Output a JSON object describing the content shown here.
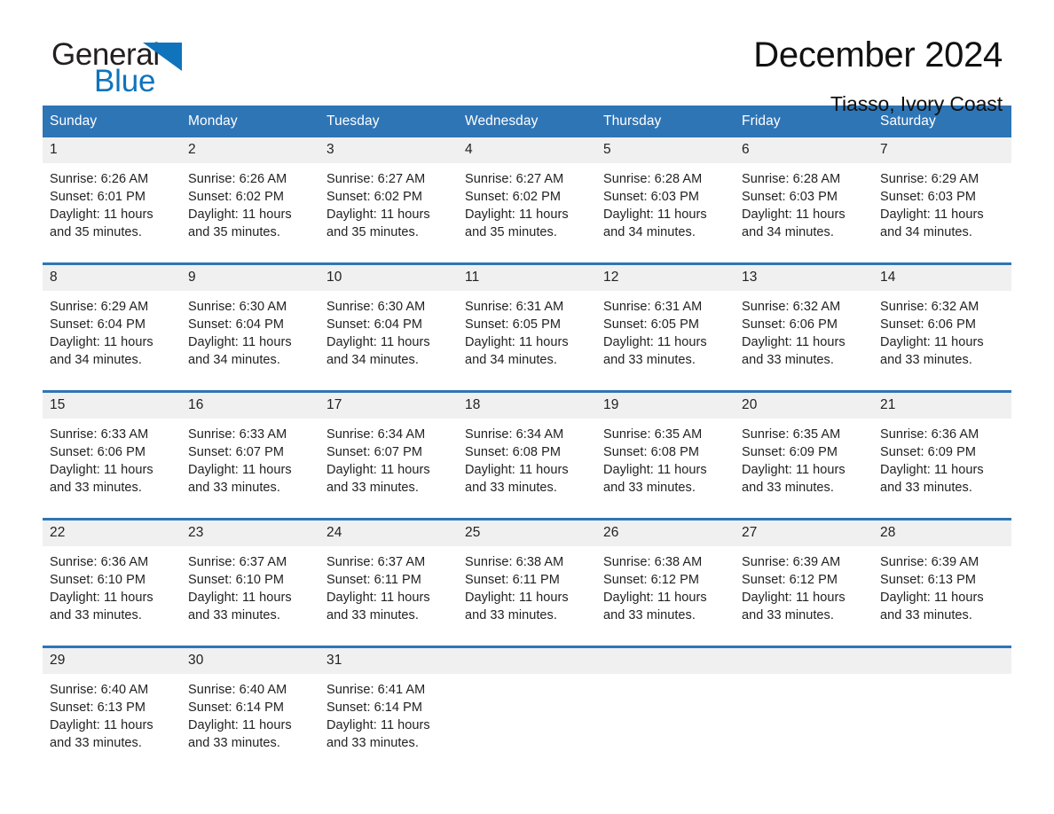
{
  "brand": {
    "name_part1": "General",
    "name_part2": "Blue",
    "logo_icon": "triangle-flag-icon",
    "accent_color": "#0f74bc"
  },
  "header": {
    "title": "December 2024",
    "subtitle": "Tiasso, Ivory Coast"
  },
  "theme": {
    "header_blue": "#2e75b6",
    "daynum_band": "#f0f0f0",
    "text": "#222222"
  },
  "calendar": {
    "weekday_headers": [
      "Sunday",
      "Monday",
      "Tuesday",
      "Wednesday",
      "Thursday",
      "Friday",
      "Saturday"
    ],
    "weeks": [
      {
        "days": [
          {
            "date": "1",
            "sunrise": "Sunrise: 6:26 AM",
            "sunset": "Sunset: 6:01 PM",
            "daylight_line1": "Daylight: 11 hours",
            "daylight_line2": "and 35 minutes."
          },
          {
            "date": "2",
            "sunrise": "Sunrise: 6:26 AM",
            "sunset": "Sunset: 6:02 PM",
            "daylight_line1": "Daylight: 11 hours",
            "daylight_line2": "and 35 minutes."
          },
          {
            "date": "3",
            "sunrise": "Sunrise: 6:27 AM",
            "sunset": "Sunset: 6:02 PM",
            "daylight_line1": "Daylight: 11 hours",
            "daylight_line2": "and 35 minutes."
          },
          {
            "date": "4",
            "sunrise": "Sunrise: 6:27 AM",
            "sunset": "Sunset: 6:02 PM",
            "daylight_line1": "Daylight: 11 hours",
            "daylight_line2": "and 35 minutes."
          },
          {
            "date": "5",
            "sunrise": "Sunrise: 6:28 AM",
            "sunset": "Sunset: 6:03 PM",
            "daylight_line1": "Daylight: 11 hours",
            "daylight_line2": "and 34 minutes."
          },
          {
            "date": "6",
            "sunrise": "Sunrise: 6:28 AM",
            "sunset": "Sunset: 6:03 PM",
            "daylight_line1": "Daylight: 11 hours",
            "daylight_line2": "and 34 minutes."
          },
          {
            "date": "7",
            "sunrise": "Sunrise: 6:29 AM",
            "sunset": "Sunset: 6:03 PM",
            "daylight_line1": "Daylight: 11 hours",
            "daylight_line2": "and 34 minutes."
          }
        ]
      },
      {
        "days": [
          {
            "date": "8",
            "sunrise": "Sunrise: 6:29 AM",
            "sunset": "Sunset: 6:04 PM",
            "daylight_line1": "Daylight: 11 hours",
            "daylight_line2": "and 34 minutes."
          },
          {
            "date": "9",
            "sunrise": "Sunrise: 6:30 AM",
            "sunset": "Sunset: 6:04 PM",
            "daylight_line1": "Daylight: 11 hours",
            "daylight_line2": "and 34 minutes."
          },
          {
            "date": "10",
            "sunrise": "Sunrise: 6:30 AM",
            "sunset": "Sunset: 6:04 PM",
            "daylight_line1": "Daylight: 11 hours",
            "daylight_line2": "and 34 minutes."
          },
          {
            "date": "11",
            "sunrise": "Sunrise: 6:31 AM",
            "sunset": "Sunset: 6:05 PM",
            "daylight_line1": "Daylight: 11 hours",
            "daylight_line2": "and 34 minutes."
          },
          {
            "date": "12",
            "sunrise": "Sunrise: 6:31 AM",
            "sunset": "Sunset: 6:05 PM",
            "daylight_line1": "Daylight: 11 hours",
            "daylight_line2": "and 33 minutes."
          },
          {
            "date": "13",
            "sunrise": "Sunrise: 6:32 AM",
            "sunset": "Sunset: 6:06 PM",
            "daylight_line1": "Daylight: 11 hours",
            "daylight_line2": "and 33 minutes."
          },
          {
            "date": "14",
            "sunrise": "Sunrise: 6:32 AM",
            "sunset": "Sunset: 6:06 PM",
            "daylight_line1": "Daylight: 11 hours",
            "daylight_line2": "and 33 minutes."
          }
        ]
      },
      {
        "days": [
          {
            "date": "15",
            "sunrise": "Sunrise: 6:33 AM",
            "sunset": "Sunset: 6:06 PM",
            "daylight_line1": "Daylight: 11 hours",
            "daylight_line2": "and 33 minutes."
          },
          {
            "date": "16",
            "sunrise": "Sunrise: 6:33 AM",
            "sunset": "Sunset: 6:07 PM",
            "daylight_line1": "Daylight: 11 hours",
            "daylight_line2": "and 33 minutes."
          },
          {
            "date": "17",
            "sunrise": "Sunrise: 6:34 AM",
            "sunset": "Sunset: 6:07 PM",
            "daylight_line1": "Daylight: 11 hours",
            "daylight_line2": "and 33 minutes."
          },
          {
            "date": "18",
            "sunrise": "Sunrise: 6:34 AM",
            "sunset": "Sunset: 6:08 PM",
            "daylight_line1": "Daylight: 11 hours",
            "daylight_line2": "and 33 minutes."
          },
          {
            "date": "19",
            "sunrise": "Sunrise: 6:35 AM",
            "sunset": "Sunset: 6:08 PM",
            "daylight_line1": "Daylight: 11 hours",
            "daylight_line2": "and 33 minutes."
          },
          {
            "date": "20",
            "sunrise": "Sunrise: 6:35 AM",
            "sunset": "Sunset: 6:09 PM",
            "daylight_line1": "Daylight: 11 hours",
            "daylight_line2": "and 33 minutes."
          },
          {
            "date": "21",
            "sunrise": "Sunrise: 6:36 AM",
            "sunset": "Sunset: 6:09 PM",
            "daylight_line1": "Daylight: 11 hours",
            "daylight_line2": "and 33 minutes."
          }
        ]
      },
      {
        "days": [
          {
            "date": "22",
            "sunrise": "Sunrise: 6:36 AM",
            "sunset": "Sunset: 6:10 PM",
            "daylight_line1": "Daylight: 11 hours",
            "daylight_line2": "and 33 minutes."
          },
          {
            "date": "23",
            "sunrise": "Sunrise: 6:37 AM",
            "sunset": "Sunset: 6:10 PM",
            "daylight_line1": "Daylight: 11 hours",
            "daylight_line2": "and 33 minutes."
          },
          {
            "date": "24",
            "sunrise": "Sunrise: 6:37 AM",
            "sunset": "Sunset: 6:11 PM",
            "daylight_line1": "Daylight: 11 hours",
            "daylight_line2": "and 33 minutes."
          },
          {
            "date": "25",
            "sunrise": "Sunrise: 6:38 AM",
            "sunset": "Sunset: 6:11 PM",
            "daylight_line1": "Daylight: 11 hours",
            "daylight_line2": "and 33 minutes."
          },
          {
            "date": "26",
            "sunrise": "Sunrise: 6:38 AM",
            "sunset": "Sunset: 6:12 PM",
            "daylight_line1": "Daylight: 11 hours",
            "daylight_line2": "and 33 minutes."
          },
          {
            "date": "27",
            "sunrise": "Sunrise: 6:39 AM",
            "sunset": "Sunset: 6:12 PM",
            "daylight_line1": "Daylight: 11 hours",
            "daylight_line2": "and 33 minutes."
          },
          {
            "date": "28",
            "sunrise": "Sunrise: 6:39 AM",
            "sunset": "Sunset: 6:13 PM",
            "daylight_line1": "Daylight: 11 hours",
            "daylight_line2": "and 33 minutes."
          }
        ]
      },
      {
        "days": [
          {
            "date": "29",
            "sunrise": "Sunrise: 6:40 AM",
            "sunset": "Sunset: 6:13 PM",
            "daylight_line1": "Daylight: 11 hours",
            "daylight_line2": "and 33 minutes."
          },
          {
            "date": "30",
            "sunrise": "Sunrise: 6:40 AM",
            "sunset": "Sunset: 6:14 PM",
            "daylight_line1": "Daylight: 11 hours",
            "daylight_line2": "and 33 minutes."
          },
          {
            "date": "31",
            "sunrise": "Sunrise: 6:41 AM",
            "sunset": "Sunset: 6:14 PM",
            "daylight_line1": "Daylight: 11 hours",
            "daylight_line2": "and 33 minutes."
          },
          {
            "date": "",
            "sunrise": "",
            "sunset": "",
            "daylight_line1": "",
            "daylight_line2": ""
          },
          {
            "date": "",
            "sunrise": "",
            "sunset": "",
            "daylight_line1": "",
            "daylight_line2": ""
          },
          {
            "date": "",
            "sunrise": "",
            "sunset": "",
            "daylight_line1": "",
            "daylight_line2": ""
          },
          {
            "date": "",
            "sunrise": "",
            "sunset": "",
            "daylight_line1": "",
            "daylight_line2": ""
          }
        ]
      }
    ]
  }
}
